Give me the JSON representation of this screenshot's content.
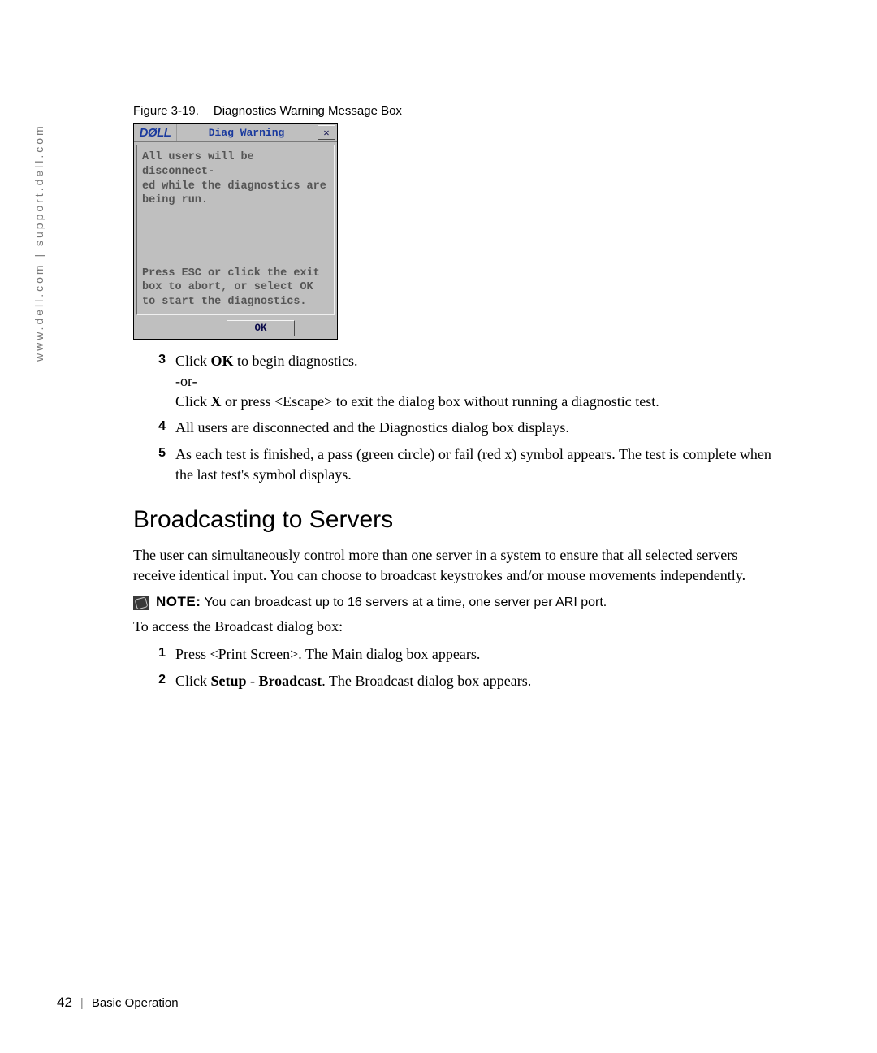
{
  "sidebar_url": "www.dell.com | support.dell.com",
  "figure": {
    "number": "Figure 3-19.",
    "title": "Diagnostics Warning Message Box"
  },
  "dialog": {
    "brand": "DØLL",
    "title": "Diag Warning",
    "close_glyph": "✕",
    "message_top": "All users will be disconnect-\ned while the diagnostics are\nbeing run.",
    "message_bottom": "Press ESC or click the exit\nbox to abort, or select OK\nto start the diagnostics.",
    "ok_label": "OK"
  },
  "steps_a": [
    {
      "n": "3",
      "parts": [
        {
          "t": "text",
          "v": "Click "
        },
        {
          "t": "bold",
          "v": "OK"
        },
        {
          "t": "text",
          "v": " to begin diagnostics."
        },
        {
          "t": "br"
        },
        {
          "t": "text",
          "v": "-or-"
        },
        {
          "t": "br"
        },
        {
          "t": "text",
          "v": "Click "
        },
        {
          "t": "bold",
          "v": "X"
        },
        {
          "t": "text",
          "v": " or press <Escape> to exit the dialog box without running a diagnostic test."
        }
      ]
    },
    {
      "n": "4",
      "parts": [
        {
          "t": "text",
          "v": "All users are disconnected and the Diagnostics dialog box displays."
        }
      ]
    },
    {
      "n": "5",
      "parts": [
        {
          "t": "text",
          "v": "As each test is finished, a pass (green circle) or fail (red x) symbol appears. The test is complete when the last test's symbol displays."
        }
      ]
    }
  ],
  "heading": "Broadcasting to Servers",
  "intro": "The user can simultaneously control more than one server in a system to ensure that all selected servers receive identical input. You can choose to broadcast keystrokes and/or mouse movements independently.",
  "note": {
    "label": "NOTE:",
    "text": "You can broadcast up to 16 servers at a time, one server per ARI port."
  },
  "access_line": "To access the Broadcast dialog box:",
  "steps_b": [
    {
      "n": "1",
      "parts": [
        {
          "t": "text",
          "v": "Press <Print Screen>. The Main dialog box appears."
        }
      ]
    },
    {
      "n": "2",
      "parts": [
        {
          "t": "text",
          "v": "Click "
        },
        {
          "t": "bold",
          "v": "Setup - Broadcast"
        },
        {
          "t": "text",
          "v": ". The Broadcast dialog box appears."
        }
      ]
    }
  ],
  "footer": {
    "page": "42",
    "sep": "|",
    "section": "Basic Operation"
  }
}
